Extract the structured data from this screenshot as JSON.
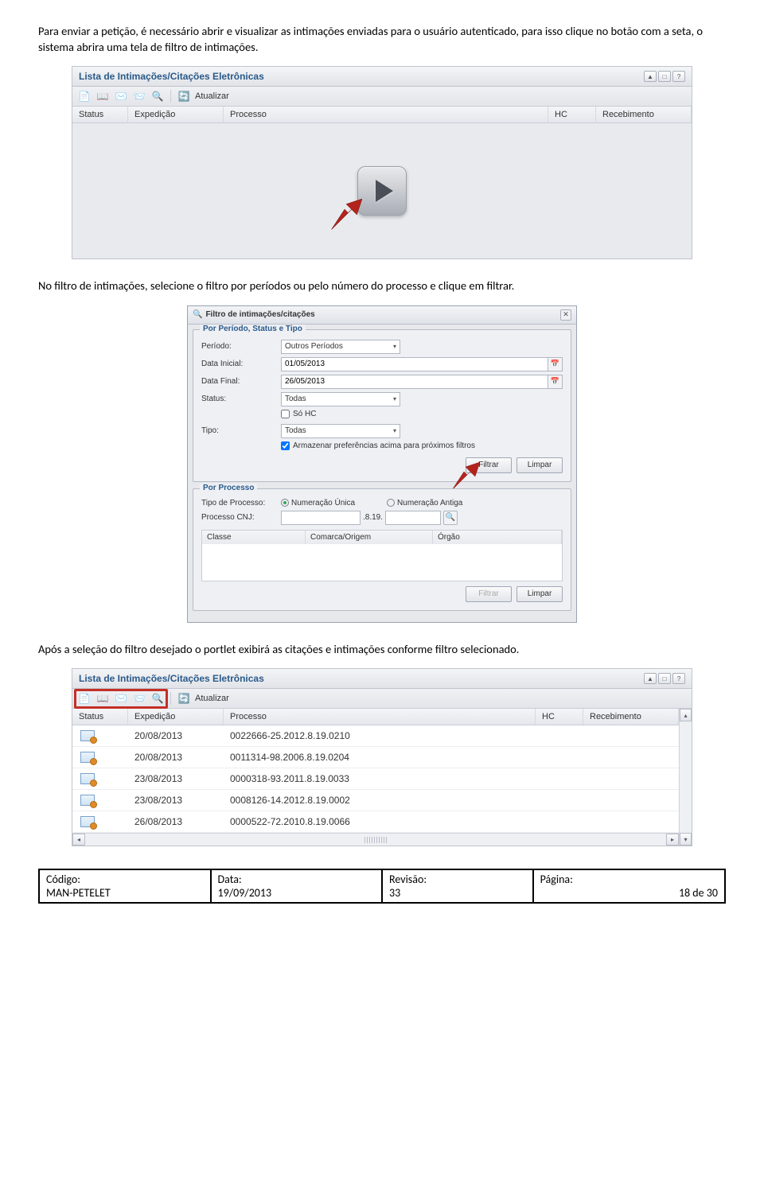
{
  "paragraphs": {
    "p1": "Para enviar a petição, é necessário abrir e visualizar as intimações enviadas para o usuário autenticado, para isso clique no botão com a seta, o sistema abrira uma tela de filtro de intimações.",
    "p2": "No filtro de intimações, selecione o filtro por períodos ou pelo número do processo e clique em filtrar.",
    "p3": "Após a seleção do filtro desejado o portlet exibirá as citações e intimações conforme filtro selecionado."
  },
  "portlet": {
    "title": "Lista de Intimações/Citações Eletrônicas",
    "refresh": "Atualizar",
    "cols": {
      "status": "Status",
      "exp": "Expedição",
      "proc": "Processo",
      "hc": "HC",
      "rec": "Recebimento"
    }
  },
  "dialog": {
    "title": "Filtro de intimações/citações",
    "fs1_legend": "Por Período, Status e Tipo",
    "fs2_legend": "Por Processo",
    "labels": {
      "periodo": "Período:",
      "dtini": "Data Inicial:",
      "dtfim": "Data Final:",
      "status": "Status:",
      "tipo": "Tipo:",
      "tipoproc": "Tipo de Processo:",
      "proccnj": "Processo CNJ:"
    },
    "values": {
      "periodo": "Outros Períodos",
      "dtini": "01/05/2013",
      "dtfim": "26/05/2013",
      "status": "Todas",
      "tipo": "Todas",
      "cnj_mid": ".8.19."
    },
    "checks": {
      "sohc": "Só HC",
      "armz": "Armazenar preferências acima para próximos filtros"
    },
    "radios": {
      "unica": "Numeração Única",
      "antiga": "Numeração Antiga"
    },
    "buttons": {
      "filtrar": "Filtrar",
      "limpar": "Limpar"
    },
    "tbl": {
      "classe": "Classe",
      "comarca": "Comarca/Origem",
      "orgao": "Órgão"
    }
  },
  "rows": [
    {
      "exp": "20/08/2013",
      "proc": "0022666-25.2012.8.19.0210"
    },
    {
      "exp": "20/08/2013",
      "proc": "0011314-98.2006.8.19.0204"
    },
    {
      "exp": "23/08/2013",
      "proc": "0000318-93.2011.8.19.0033"
    },
    {
      "exp": "23/08/2013",
      "proc": "0008126-14.2012.8.19.0002"
    },
    {
      "exp": "26/08/2013",
      "proc": "0000522-72.2010.8.19.0066"
    }
  ],
  "footer": {
    "codigo_k": "Código:",
    "codigo_v": "MAN-PETELET",
    "data_k": "Data:",
    "data_v": "19/09/2013",
    "rev_k": "Revisão:",
    "rev_v": "33",
    "pag_k": "Página:",
    "pag_v": "18 de 30"
  }
}
